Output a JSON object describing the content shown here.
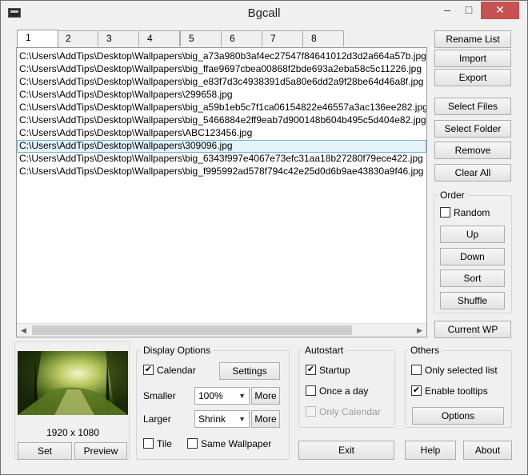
{
  "window": {
    "title": "Bgcall",
    "controls": {
      "minimize": "–",
      "maximize": "□",
      "close": "✕"
    }
  },
  "tabs": [
    "1",
    "2",
    "3",
    "4",
    "5",
    "6",
    "7",
    "8"
  ],
  "file_list": {
    "items": [
      "C:\\Users\\AddTips\\Desktop\\Wallpapers\\big_a73a980b3af4ec27547f84641012d3d2a664a57b.jpg",
      "C:\\Users\\AddTips\\Desktop\\Wallpapers\\big_ffae9697cbea00868f2bde693a2eba58c5c11226.jpg",
      "C:\\Users\\AddTips\\Desktop\\Wallpapers\\big_e83f7d3c4938391d5a80e6dd2a9f28be64d46a8f.jpg",
      "C:\\Users\\AddTips\\Desktop\\Wallpapers\\299658.jpg",
      "C:\\Users\\AddTips\\Desktop\\Wallpapers\\big_a59b1eb5c7f1ca06154822e46557a3ac136ee282.jpg",
      "C:\\Users\\AddTips\\Desktop\\Wallpapers\\big_5466884e2ff9eab7d900148b604b495c5d404e82.jpg",
      "C:\\Users\\AddTips\\Desktop\\Wallpapers\\ABC123456.jpg",
      "C:\\Users\\AddTips\\Desktop\\Wallpapers\\309096.jpg",
      "C:\\Users\\AddTips\\Desktop\\Wallpapers\\big_6343f997e4067e73efc31aa18b27280f79ece422.jpg",
      "C:\\Users\\AddTips\\Desktop\\Wallpapers\\big_f995992ad578f794c42e25d0d6b9ae43830a9f46.jpg"
    ],
    "selected_index": 7
  },
  "side_buttons": {
    "rename_list": "Rename List",
    "import": "Import",
    "export": "Export",
    "select_files": "Select Files",
    "select_folder": "Select Folder",
    "remove": "Remove",
    "clear_all": "Clear All",
    "current_wp": "Current WP"
  },
  "order": {
    "label": "Order",
    "random_label": "Random",
    "random_checked": false,
    "up": "Up",
    "down": "Down",
    "sort": "Sort",
    "shuffle": "Shuffle"
  },
  "preview": {
    "resolution": "1920 x 1080",
    "set": "Set",
    "preview": "Preview"
  },
  "display_options": {
    "label": "Display Options",
    "calendar_label": "Calendar",
    "calendar_checked": true,
    "settings": "Settings",
    "smaller_label": "Smaller",
    "smaller_value": "100%",
    "larger_label": "Larger",
    "larger_value": "Shrink",
    "more": "More",
    "tile_label": "Tile",
    "tile_checked": false,
    "same_wallpaper_label": "Same Wallpaper",
    "same_wallpaper_checked": false
  },
  "autostart": {
    "label": "Autostart",
    "startup_label": "Startup",
    "startup_checked": true,
    "once_a_day_label": "Once a day",
    "once_a_day_checked": false,
    "only_calendar_label": "Only Calendar",
    "only_calendar_checked": false
  },
  "others": {
    "label": "Others",
    "only_selected_label": "Only selected list",
    "only_selected_checked": false,
    "enable_tooltips_label": "Enable tooltips",
    "enable_tooltips_checked": true,
    "options": "Options"
  },
  "bottom_buttons": {
    "exit": "Exit",
    "help": "Help",
    "about": "About"
  },
  "scroll_arrows": {
    "left": "◀",
    "right": "▶"
  }
}
